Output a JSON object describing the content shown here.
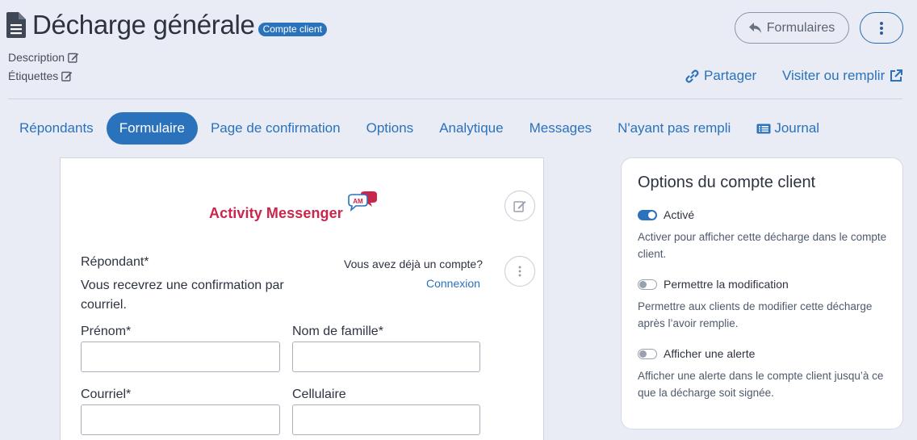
{
  "header": {
    "title": "Décharge générale",
    "badge": "Compte client",
    "description_label": "Description",
    "tags_label": "Étiquettes",
    "forms_button": "Formulaires",
    "share_label": "Partager",
    "visit_label": "Visiter ou remplir"
  },
  "tabs": [
    {
      "label": "Répondants"
    },
    {
      "label": "Formulaire"
    },
    {
      "label": "Page de confirmation"
    },
    {
      "label": "Options"
    },
    {
      "label": "Analytique"
    },
    {
      "label": "Messages"
    },
    {
      "label": "N'ayant pas rempli"
    },
    {
      "label": "Journal"
    }
  ],
  "form": {
    "logo_text": "Activity Messenger",
    "logo_badge": "AM",
    "respondent_label": "Répondant*",
    "confirmation_text": "Vous recevrez une confirmation par courriel.",
    "account_question": "Vous avez déjà un compte?",
    "login_link": "Connexion",
    "first_name_label": "Prénom*",
    "last_name_label": "Nom de famille*",
    "email_label": "Courriel*",
    "cell_label": "Cellulaire",
    "first_name_value": "",
    "last_name_value": "",
    "email_value": "",
    "cell_value": ""
  },
  "options": {
    "title": "Options du compte client",
    "items": [
      {
        "label": "Activé",
        "enabled": true,
        "description": "Activer pour afficher cette décharge dans le compte client."
      },
      {
        "label": "Permettre la modification",
        "enabled": false,
        "description": "Permettre aux clients de modifier cette décharge après l’avoir remplie."
      },
      {
        "label": "Afficher une alerte",
        "enabled": false,
        "description": "Afficher une alerte dans le compte client jusqu’à ce que la décharge soit signée."
      }
    ]
  },
  "colors": {
    "accent": "#2a72bc",
    "brand": "#c8264a",
    "background": "#e9ecf4"
  }
}
